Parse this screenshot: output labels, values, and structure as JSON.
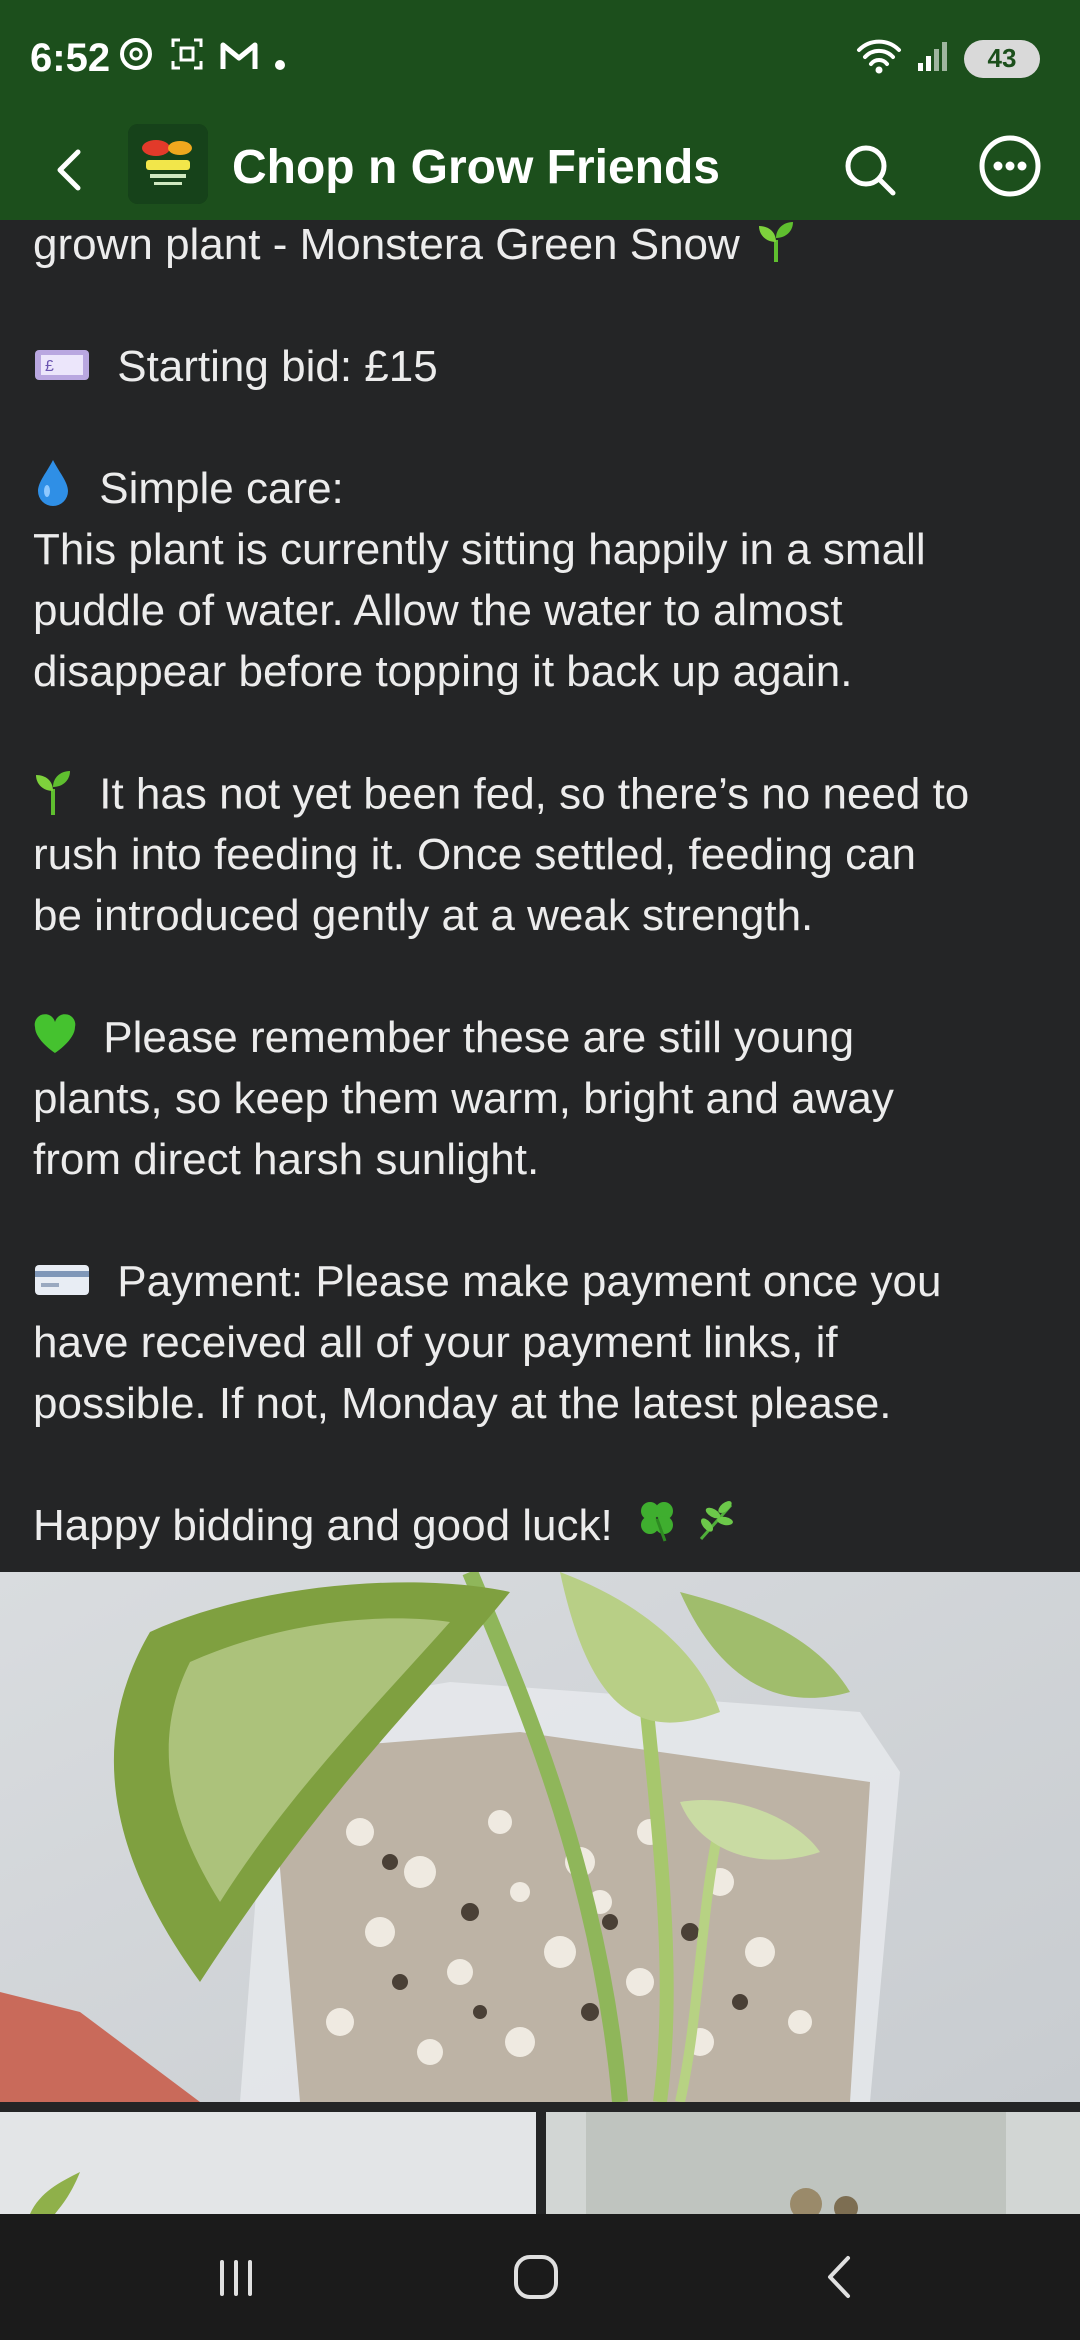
{
  "status": {
    "time": "6:52",
    "battery": "43",
    "left_icons": [
      "threads-icon",
      "screenshot-icon",
      "gmail-icon",
      "dot-icon"
    ],
    "right_icons": [
      "wifi-icon",
      "signal-icon",
      "battery-icon"
    ]
  },
  "app_bar": {
    "title": "Chop n Grow Friends"
  },
  "post": {
    "lines": {
      "l1": "grown plant - Monstera Green Snow",
      "l2": "Starting bid: £15",
      "l3": "Simple care:",
      "l4": "This plant is currently sitting happily in a small",
      "l5": "puddle of water. Allow the water to almost",
      "l6": "disappear before topping it back up again.",
      "l7": "It has not yet been fed, so there’s no need to",
      "l8": "rush into feeding it. Once settled, feeding can",
      "l9": "be introduced gently at a weak strength.",
      "l10": "Please remember these are still young",
      "l11": "plants, so keep them warm, bright and away",
      "l12": "from direct harsh sunlight.",
      "l13": "Payment: Please make payment once you",
      "l14": "have received all of your payment links, if",
      "l15": "possible. If not, Monday at the latest please.",
      "l16": "Happy bidding and good luck!"
    },
    "icons": [
      "seedling-icon",
      "money-icon",
      "droplet-icon",
      "seedling-icon",
      "green-heart-icon",
      "credit-card-icon",
      "clover-icon",
      "herb-icon"
    ]
  },
  "colors": {
    "header_green": "#1c4f1c",
    "background": "#242526",
    "text": "#ececec"
  }
}
